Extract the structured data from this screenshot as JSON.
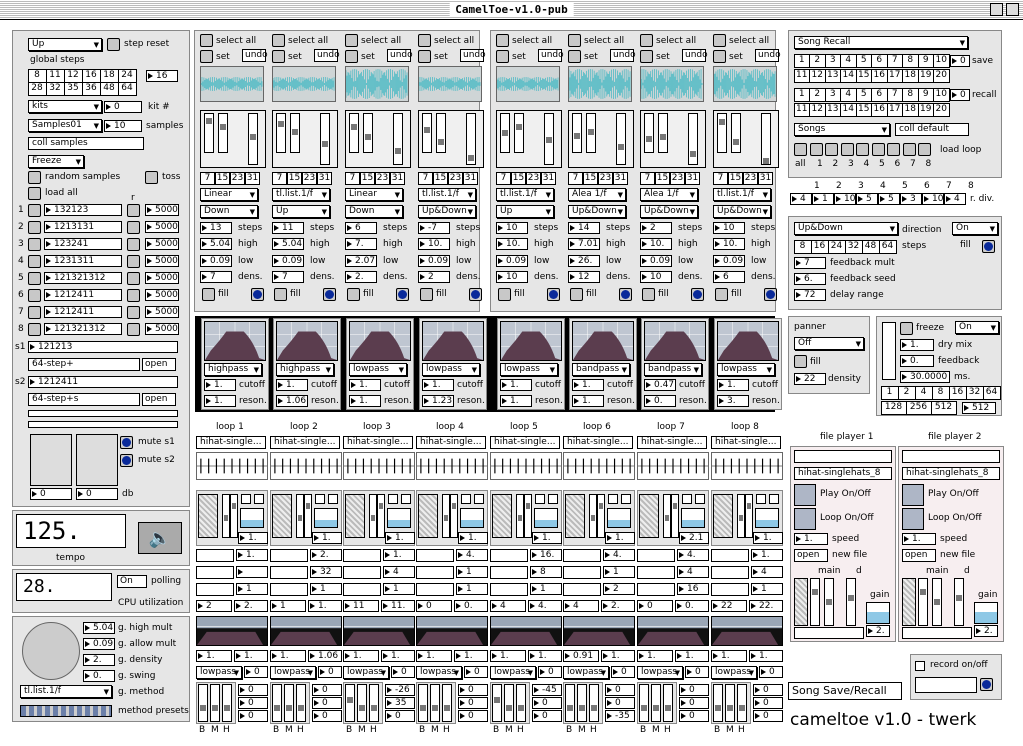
{
  "window": {
    "title": "CamelToe-v1.0-pub"
  },
  "global": {
    "direction": "Up",
    "step_reset": "step reset",
    "global_steps_label": "global steps",
    "steps_values": [
      "8",
      "11",
      "12",
      "16",
      "18",
      "24",
      "28",
      "32",
      "35",
      "36",
      "48",
      "64"
    ],
    "steps_num": "16",
    "kits_dd": "kits",
    "kit_num": "0",
    "kit_label": "kit #",
    "samples_dd": "Samples01",
    "samples_num": "10",
    "samples_label": "samples",
    "coll_samples": "coll samples",
    "freeze_dd": "Freeze",
    "random_samples": "random samples",
    "toss": "toss",
    "load_all": "load all",
    "r_label": "r",
    "rows": [
      {
        "n": "1",
        "p": "132123",
        "v": "5000"
      },
      {
        "n": "2",
        "p": "1213131",
        "v": "5000"
      },
      {
        "n": "3",
        "p": "123241",
        "v": "5000"
      },
      {
        "n": "4",
        "p": "1231311",
        "v": "5000"
      },
      {
        "n": "5",
        "p": "121321312",
        "v": "5000"
      },
      {
        "n": "6",
        "p": "1212411",
        "v": "5000"
      },
      {
        "n": "7",
        "p": "1212411",
        "v": "5000"
      },
      {
        "n": "8",
        "p": "121321312",
        "v": "5000"
      }
    ],
    "s1_label": "s1",
    "s1_pattern": "121213",
    "s1_name": "64-step+",
    "open": "open",
    "s2_label": "s2",
    "s2_pattern": "1212411",
    "s2_name": "64-step+s",
    "mute_s1": "mute s1",
    "mute_s2": "mute s2",
    "db_left": "0",
    "db_right": "0",
    "db_label": "db"
  },
  "tempo": {
    "value": "125.",
    "label": "tempo"
  },
  "cpu": {
    "value": "28.",
    "on": "On",
    "polling": "polling",
    "label": "CPU utilization"
  },
  "gparams": {
    "values": [
      "5.04",
      "0.09",
      "2.",
      "0."
    ],
    "labels": [
      "g. high mult",
      "g. allow mult",
      "g. density",
      "g. swing"
    ],
    "method_dd": "tl.list.1/f",
    "method_label": "g. method",
    "presets_label": "method presets"
  },
  "seq_common": {
    "select_all": "select all",
    "set": "set",
    "undo": "undo",
    "fill": "fill",
    "steps": "steps",
    "high": "high",
    "low": "low",
    "dens": "dens.",
    "cutoff": "cutoff",
    "reson": "reson.",
    "nums": [
      "7",
      "15",
      "23",
      "31"
    ]
  },
  "tracks": [
    {
      "m1": "Linear",
      "m2": "Down",
      "steps": "13",
      "high": "5.04",
      "low": "0.09",
      "dens": "7",
      "filter": "highpass",
      "cutoff": "1.",
      "reson": "1."
    },
    {
      "m1": "tl.list.1/f",
      "m2": "Up",
      "steps": "11",
      "high": "5.04",
      "low": "0.09",
      "dens": "7",
      "filter": "highpass",
      "cutoff": "1.",
      "reson": "1.06"
    },
    {
      "m1": "Linear",
      "m2": "Down",
      "steps": "6",
      "high": "7.",
      "low": "2.07",
      "dens": "2.",
      "filter": "lowpass",
      "cutoff": "1.",
      "reson": "1."
    },
    {
      "m1": "tl.list.1/f",
      "m2": "Up&Down",
      "steps": "-7",
      "high": "10.",
      "low": "0.09",
      "dens": "2",
      "filter": "lowpass",
      "cutoff": "1.",
      "reson": "1.23"
    },
    {
      "m1": "tl.list.1/f",
      "m2": "Up",
      "steps": "10",
      "high": "10.",
      "low": "0.09",
      "dens": "10",
      "filter": "lowpass",
      "cutoff": "1.",
      "reson": "1."
    },
    {
      "m1": "Alea 1/f",
      "m2": "Up&Down",
      "steps": "14",
      "high": "7.01",
      "low": "26.",
      "dens": "12",
      "filter": "bandpass",
      "cutoff": "1.",
      "reson": "1."
    },
    {
      "m1": "Alea 1/f",
      "m2": "Up&Down",
      "steps": "2",
      "high": "10.",
      "low": "0.09",
      "dens": "10",
      "filter": "bandpass",
      "cutoff": "0.47",
      "reson": "0."
    },
    {
      "m1": "tl.list.1/f",
      "m2": "Up&Down",
      "steps": "10",
      "high": "10.",
      "low": "0.09",
      "dens": "6",
      "filter": "lowpass",
      "cutoff": "1.",
      "reson": "3."
    }
  ],
  "loops": [
    {
      "label": "loop 1",
      "name": "hihat-single...",
      "a": "1.",
      "b": "1.",
      "c": "",
      "d": "1",
      "e": "2",
      "f": "2.",
      "g": "1.",
      "h": "1.",
      "i": "0",
      "v": [
        "0",
        "0",
        "0"
      ]
    },
    {
      "label": "loop 2",
      "name": "hihat-single...",
      "a": "1.",
      "b": "2.",
      "c": "32",
      "d": "1",
      "e": "1",
      "f": "1.",
      "g": "1.",
      "h": "1.06",
      "i": "0",
      "v": [
        "0",
        "0",
        "0"
      ]
    },
    {
      "label": "loop 3",
      "name": "hihat-single...",
      "a": "1.",
      "b": "1.",
      "c": "4",
      "d": "1",
      "e": "11",
      "f": "11.",
      "g": "1.",
      "h": "1.",
      "i": "0",
      "v": [
        "-26",
        "35",
        "0"
      ]
    },
    {
      "label": "loop 4",
      "name": "hihat-single...",
      "a": "1.",
      "b": "4.",
      "c": "1",
      "d": "1",
      "e": "0",
      "f": "0.",
      "g": "1.",
      "h": "1.",
      "i": "0",
      "v": [
        "0",
        "0",
        "0"
      ]
    },
    {
      "label": "loop 5",
      "name": "hihat-single...",
      "a": "1.",
      "b": "16.",
      "c": "8",
      "d": "1",
      "e": "4",
      "f": "4.",
      "g": "1.",
      "h": "1.",
      "i": "0",
      "v": [
        "-45",
        "0",
        "0"
      ]
    },
    {
      "label": "loop 6",
      "name": "hihat-single...",
      "a": "1.",
      "b": "4.",
      "c": "1",
      "d": "2",
      "e": "4",
      "f": "2.",
      "g": "0.91",
      "h": "1.",
      "i": "0",
      "v": [
        "0",
        "0",
        "-35"
      ]
    },
    {
      "label": "loop 7",
      "name": "hihat-single...",
      "a": "2.1",
      "b": "4.",
      "c": "4",
      "d": "16",
      "e": "0",
      "f": "0.",
      "g": "1.",
      "h": "1.",
      "i": "0",
      "v": [
        "0",
        "0",
        "0"
      ]
    },
    {
      "label": "loop 8",
      "name": "hihat-single...",
      "a": "1.",
      "b": "1.",
      "c": "4",
      "d": "1",
      "e": "22",
      "f": "22.",
      "g": "1.",
      "h": "1.",
      "i": "0",
      "v": [
        "0",
        "0",
        "0"
      ]
    }
  ],
  "loop_common": {
    "filter": "lowpass",
    "b": "B",
    "m": "M",
    "h": "H"
  },
  "song": {
    "dd": "Song Recall",
    "save": "save",
    "recall": "recall",
    "save_num": "0",
    "recall_num": "0",
    "songs_dd": "Songs",
    "coll_default": "coll default",
    "load_loop": "load loop",
    "all": "all",
    "nums": [
      "1",
      "2",
      "3",
      "4",
      "5",
      "6",
      "7",
      "8",
      "9",
      "10",
      "11",
      "12",
      "13",
      "14",
      "15",
      "16",
      "17",
      "18",
      "19",
      "20"
    ],
    "small": [
      "1",
      "2",
      "3",
      "4",
      "5",
      "6",
      "7",
      "8"
    ]
  },
  "rdiv": {
    "top": [
      "1",
      "2",
      "3",
      "4",
      "5",
      "6",
      "7",
      "8"
    ],
    "vals": [
      "4",
      "1",
      "10",
      "5",
      "5",
      "3",
      "10",
      "4"
    ],
    "label": "r. div."
  },
  "delay": {
    "dd": "Up&Down",
    "direction": "direction",
    "on": "On",
    "fill": "fill",
    "steps_vals": [
      "8",
      "16",
      "24",
      "32",
      "48",
      "64"
    ],
    "steps": "steps",
    "fm": "7",
    "fm_label": "feedback mult",
    "fs": "6.",
    "fs_label": "feedback seed",
    "dr": "72",
    "dr_label": "delay range"
  },
  "panner": {
    "title": "panner",
    "dd": "Off",
    "fill": "fill",
    "density": "22",
    "density_label": "density"
  },
  "freeze": {
    "label": "freeze",
    "on": "On",
    "dry": "1.",
    "dry_label": "dry mix",
    "fb": "0.",
    "fb_label": "feedback",
    "ms": "30.0000",
    "ms_label": "ms.",
    "grid": [
      "1",
      "2",
      "4",
      "8",
      "16",
      "32",
      "64",
      "128",
      "256",
      "512"
    ],
    "out": "512"
  },
  "fp1": {
    "title": "file player 1",
    "file": "hihat-singlehats_8",
    "play": "Play On/Off",
    "loop": "Loop On/Off",
    "speed": "1.",
    "speed_label": "speed",
    "open": "open",
    "new_file": "new file",
    "main": "main",
    "d": "d",
    "gain": "gain",
    "gain_val": "2."
  },
  "fp2": {
    "title": "file player 2",
    "file": "hihat-singlehats_8",
    "play": "Play On/Off",
    "loop": "Loop On/Off",
    "speed": "1.",
    "speed_label": "speed",
    "open": "open",
    "new_file": "new file",
    "main": "main",
    "d": "d",
    "gain": "gain",
    "gain_val": "2."
  },
  "record": {
    "label": "record on/off"
  },
  "bottom": {
    "save_recall": "Song Save/Recall",
    "title": "cameltoe v1.0 - twerk"
  }
}
